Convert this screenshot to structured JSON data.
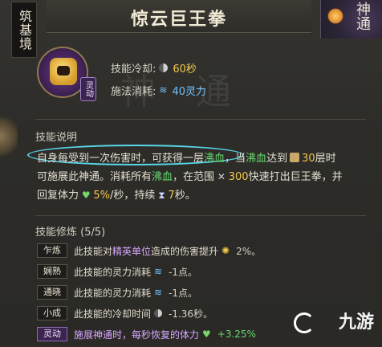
{
  "window": {
    "title": "惊云巨王拳",
    "realm_tag": "筑基境",
    "deity_badge": "神通"
  },
  "skill": {
    "type_badge": "灵动",
    "cooldown_label": "技能冷却:",
    "cooldown_value": "60秒",
    "cost_label": "施法消耗:",
    "cost_value": "40灵力",
    "bg_deco": "神 通"
  },
  "description": {
    "heading": "技能说明",
    "line1_a": "自身每受到一次伤害时，可获得一层",
    "line1_b": "沸血",
    "line1_c": "，当",
    "line1_d": "沸血",
    "line1_e": "达到",
    "line1_f": "30",
    "line1_g": "层时",
    "line2_a": "可施展此神通。消耗所有",
    "line2_b": "沸血",
    "line2_c": "，在范围",
    "line2_d": "300",
    "line2_e": "快速打出巨王拳，并",
    "line3_a": "回复体力",
    "line3_b": "5%",
    "line3_c": "/秒，持续",
    "line3_d": "7",
    "line3_e": "秒。"
  },
  "modifiers": {
    "heading": "技能修炼 (5/5)",
    "rows": [
      {
        "tag": "乍炼",
        "text_a": "此技能对",
        "text_b": "精英单位",
        "text_c": "造成的伤害提升",
        "value": "2%。"
      },
      {
        "tag": "娴熟",
        "text_a": "此技能的灵力消耗",
        "value": "-1点。"
      },
      {
        "tag": "通晓",
        "text_a": "此技能的灵力消耗",
        "value": "-1点。"
      },
      {
        "tag": "小成",
        "text_a": "此技能的冷却时间",
        "value": "-1.36秒。"
      },
      {
        "tag": "灵动",
        "text_a": "施展神通时，每秒恢复的体力",
        "value": "+3.25%"
      }
    ]
  },
  "watermark": "九游",
  "colors": {
    "accent_gold": "#f2c94c",
    "accent_blue": "#6fc2ff",
    "accent_green": "#66d96e",
    "highlight_ring": "#59d6e8",
    "purple_text": "#d7a7ff"
  }
}
